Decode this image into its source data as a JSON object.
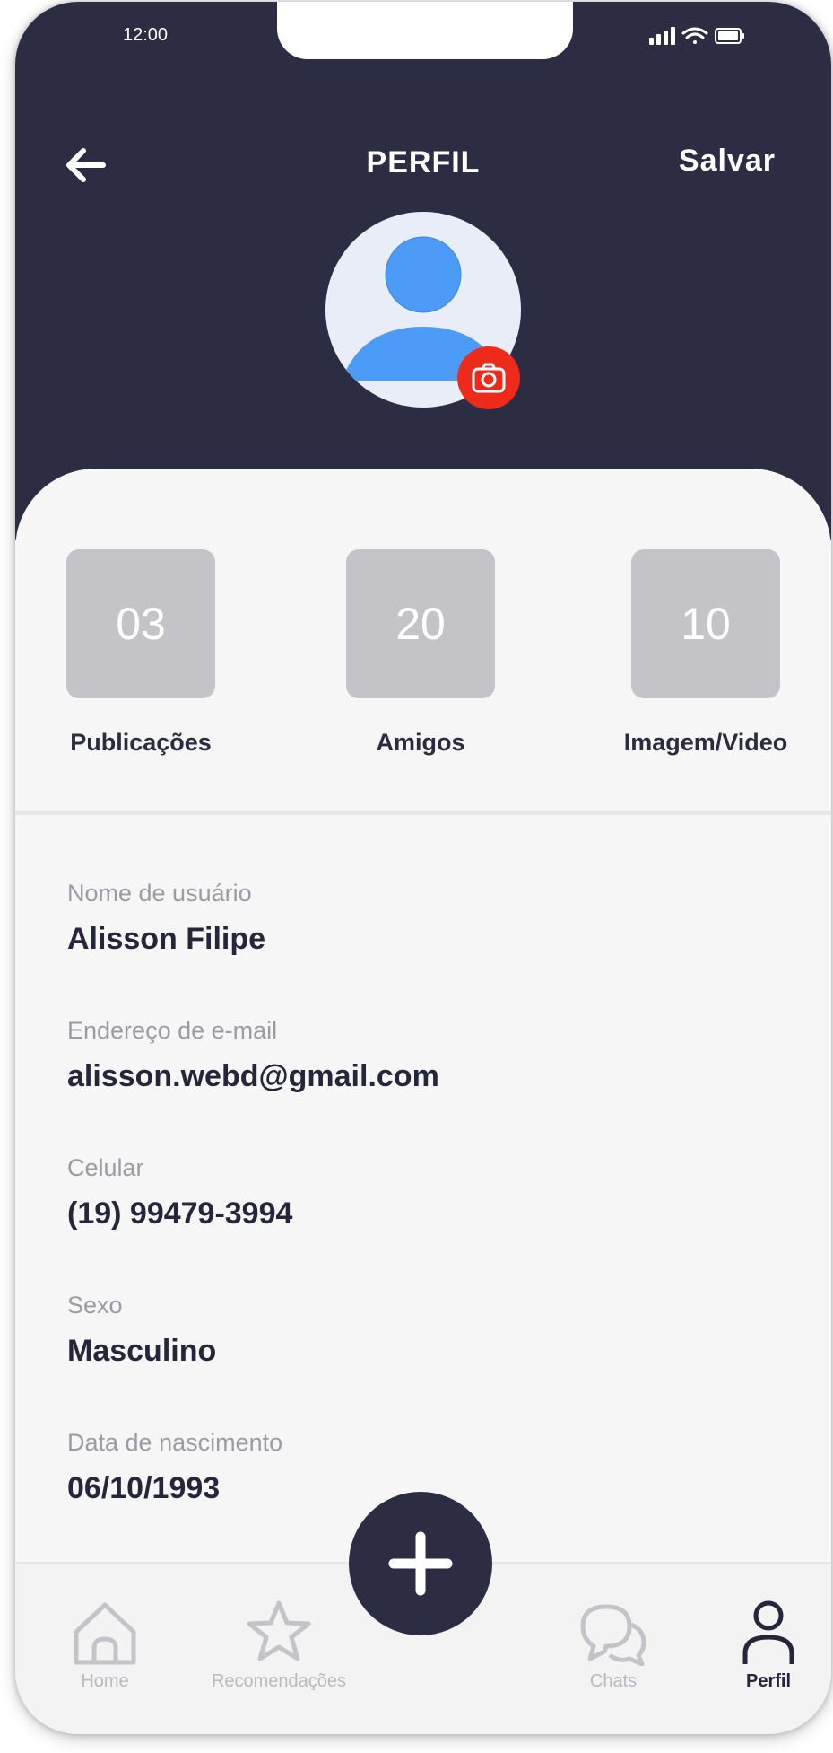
{
  "status": {
    "time": "12:00"
  },
  "header": {
    "title": "PERFIL",
    "save_label": "Salvar"
  },
  "stats": [
    {
      "value": "03",
      "label": "Publicações"
    },
    {
      "value": "20",
      "label": "Amigos"
    },
    {
      "value": "10",
      "label": "Imagem/Video"
    }
  ],
  "fields": [
    {
      "label": "Nome de usuário",
      "value": "Alisson Filipe"
    },
    {
      "label": "Endereço de e-mail",
      "value": "alisson.webd@gmail.com"
    },
    {
      "label": "Celular",
      "value": "(19) 99479-3994"
    },
    {
      "label": "Sexo",
      "value": "Masculino"
    },
    {
      "label": "Data de nascimento",
      "value": "06/10/1993"
    }
  ],
  "nav": {
    "items": [
      {
        "label": "Home",
        "icon": "home-icon"
      },
      {
        "label": "Recomendações",
        "icon": "star-icon"
      },
      {
        "label": "Chats",
        "icon": "chat-icon"
      },
      {
        "label": "Perfil",
        "icon": "user-icon"
      }
    ],
    "active": "Perfil"
  },
  "colors": {
    "header_bg": "#2c2d43",
    "accent_red": "#ee2a1b",
    "avatar_blue": "#4b9bf7",
    "stat_box": "#c3c3c8"
  }
}
